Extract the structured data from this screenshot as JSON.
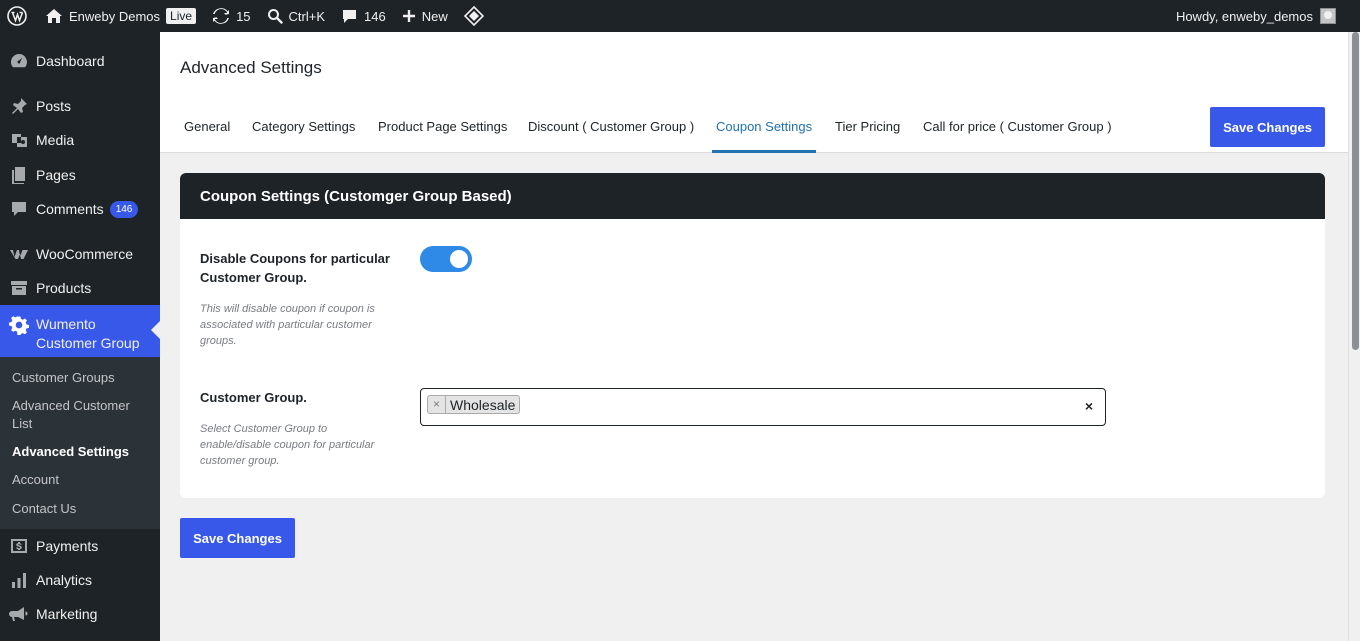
{
  "admin_bar": {
    "site_name": "Enweby Demos",
    "live_badge": "Live",
    "updates_count": "15",
    "search_shortcut": "Ctrl+K",
    "comments_count": "146",
    "new_label": "New",
    "howdy": "Howdy, enweby_demos"
  },
  "sidebar": {
    "dashboard": "Dashboard",
    "posts": "Posts",
    "media": "Media",
    "pages": "Pages",
    "comments": "Comments",
    "comments_badge": "146",
    "woocommerce": "WooCommerce",
    "products": "Products",
    "wumento_line1": "Wumento",
    "wumento_line2": "Customer Group",
    "submenu": {
      "customer_groups": "Customer Groups",
      "advanced_customer_list": "Advanced Customer List",
      "advanced_settings": "Advanced Settings",
      "account": "Account",
      "contact_us": "Contact Us"
    },
    "payments": "Payments",
    "analytics": "Analytics",
    "marketing": "Marketing"
  },
  "page": {
    "title": "Advanced Settings",
    "tabs": {
      "general": "General",
      "category_settings": "Category Settings",
      "product_page_settings": "Product Page Settings",
      "discount": "Discount ( Customer Group )",
      "coupon_settings": "Coupon Settings",
      "tier_pricing": "Tier Pricing",
      "call_for_price": "Call for price ( Customer Group )"
    },
    "save_label": "Save Changes",
    "card": {
      "title": "Coupon Settings (Customger Group Based)",
      "disable_label": "Disable Coupons for particular Customer Group.",
      "disable_desc": "This will disable coupon if coupon is associated with particular customer groups.",
      "disable_enabled": true,
      "group_label": "Customer Group.",
      "group_desc": "Select Customer Group to enable/disable coupon for particular customer group.",
      "selected_group": "Wholesale",
      "tag_remove": "×",
      "clear": "×"
    }
  },
  "colors": {
    "admin_dark": "#1d2327",
    "accent": "#3858e9",
    "tab_active": "#2271b1",
    "toggle_on": "#2e8ae6"
  }
}
